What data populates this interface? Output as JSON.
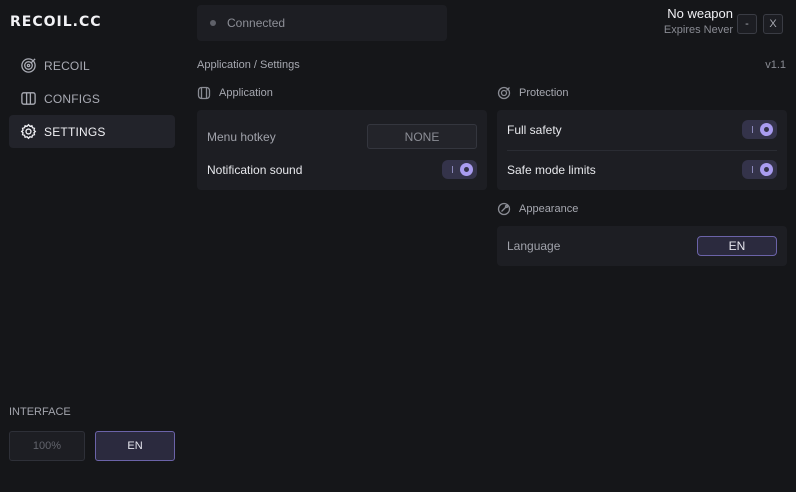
{
  "app": {
    "brand": "RECOIL.CC",
    "version": "v1.1"
  },
  "nav": {
    "items": [
      {
        "label": "RECOIL",
        "icon": "target-icon",
        "active": false
      },
      {
        "label": "CONFIGS",
        "icon": "configs-icon",
        "active": false
      },
      {
        "label": "SETTINGS",
        "icon": "gear-icon",
        "active": true
      }
    ]
  },
  "interface": {
    "label": "INTERFACE",
    "zoom": "100%",
    "language": "EN"
  },
  "status": {
    "text": "Connected"
  },
  "weapon": {
    "name": "No weapon",
    "expires": "Expires Never"
  },
  "window": {
    "minimize": "-",
    "close": "X"
  },
  "breadcrumb": "Application / Settings",
  "application": {
    "title": "Application",
    "menu_hotkey_label": "Menu hotkey",
    "menu_hotkey_value": "NONE",
    "notification_label": "Notification sound",
    "notification_on": true
  },
  "protection": {
    "title": "Protection",
    "full_safety_label": "Full safety",
    "full_safety_on": true,
    "safe_mode_label": "Safe mode limits",
    "safe_mode_on": true
  },
  "appearance": {
    "title": "Appearance",
    "language_label": "Language",
    "language_value": "EN"
  },
  "colors": {
    "background": "#151619",
    "panel": "#1d1e23",
    "accent": "#a99cf0",
    "accent_border": "#6b63a8"
  }
}
